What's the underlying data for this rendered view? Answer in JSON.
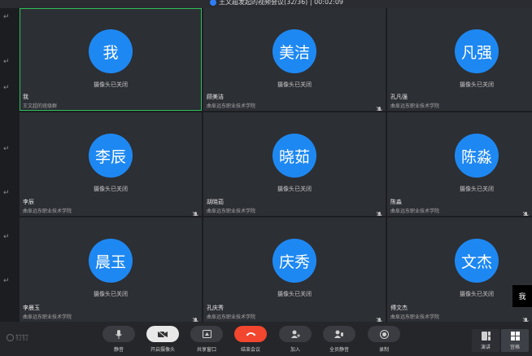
{
  "meeting": {
    "title": "王文超发起的视频会议(32/36) | 00:02:09"
  },
  "participants": [
    {
      "avatar": "我",
      "status": "摄像头已关闭",
      "name": "我",
      "org": "王文超的班级群",
      "active": true,
      "muted": false
    },
    {
      "avatar": "美洁",
      "status": "摄像头已关闭",
      "name": "顾美洁",
      "org": "曲阜远东职业技术学院",
      "active": false,
      "muted": true
    },
    {
      "avatar": "凡强",
      "status": "摄像头已关闭",
      "name": "孔凡强",
      "org": "曲阜远东职业技术学院",
      "active": false,
      "muted": false
    },
    {
      "avatar": "李辰",
      "status": "摄像头已关闭",
      "name": "李辰",
      "org": "曲阜远东职业技术学院",
      "active": false,
      "muted": true
    },
    {
      "avatar": "晓茹",
      "status": "摄像头已关闭",
      "name": "胡晓茹",
      "org": "曲阜远东职业技术学院",
      "active": false,
      "muted": true
    },
    {
      "avatar": "陈淼",
      "status": "摄像头已关闭",
      "name": "陈淼",
      "org": "曲阜远东职业技术学院",
      "active": false,
      "muted": true
    },
    {
      "avatar": "晨玉",
      "status": "摄像头已关闭",
      "name": "李晨玉",
      "org": "曲阜远东职业技术学院",
      "active": false,
      "muted": true
    },
    {
      "avatar": "庆秀",
      "status": "摄像头已关闭",
      "name": "孔庆秀",
      "org": "曲阜远东职业技术学院",
      "active": false,
      "muted": true
    },
    {
      "avatar": "文杰",
      "status": "摄像头已关闭",
      "name": "傅文杰",
      "org": "曲阜远东职业技术学院",
      "active": false,
      "muted": true
    }
  ],
  "me_badge": "我",
  "brand": "钉钉",
  "toolbar": {
    "mute": "静音",
    "camera": "开启摄像头",
    "share": "共享窗口",
    "end": "结束会议",
    "add": "加入",
    "mute_all": "全员静音",
    "record": "录制"
  },
  "view": {
    "speaker": "演讲",
    "gallery": "宫格"
  },
  "colors": {
    "avatar": "#1e88f2",
    "end_button": "#f2462e",
    "active_border": "#2fbf5a"
  }
}
